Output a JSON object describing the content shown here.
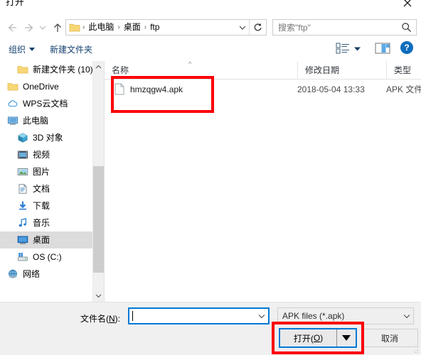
{
  "window": {
    "title": "打开",
    "close_label": "×",
    "close_icon": "close-icon"
  },
  "navigation": {
    "back_icon": "arrow-left-icon",
    "forward_icon": "arrow-right-icon",
    "recent_icon": "chevron-down-icon",
    "up_icon": "arrow-up-icon",
    "address": {
      "folder_icon": "folder-icon",
      "crumbs": [
        "此电脑",
        "桌面",
        "ftp"
      ],
      "separator": "›",
      "dropdown_icon": "chevron-down-icon",
      "refresh_icon": "refresh-icon"
    },
    "search": {
      "placeholder": "搜索\"ftp\"",
      "icon": "search-icon"
    }
  },
  "toolbar": {
    "organize_label": "组织",
    "new_folder_label": "新建文件夹",
    "view_options_icon": "view-options-icon",
    "view_caret_icon": "chevron-down-icon",
    "preview_pane_icon": "preview-pane-icon",
    "help_label": "?",
    "help_icon": "help-icon"
  },
  "sidebar": {
    "items": [
      {
        "label": "新建文件夹 (10)",
        "icon": "folder-icon",
        "indent": true,
        "selected": false
      },
      {
        "label": "OneDrive",
        "icon": "folder-icon",
        "indent": false,
        "selected": false
      },
      {
        "label": "WPS云文档",
        "icon": "cloud-icon",
        "indent": false,
        "selected": false
      },
      {
        "label": "此电脑",
        "icon": "this-pc-icon",
        "indent": false,
        "selected": false
      },
      {
        "label": "3D 对象",
        "icon": "3d-objects-icon",
        "indent": true,
        "selected": false
      },
      {
        "label": "视频",
        "icon": "videos-icon",
        "indent": true,
        "selected": false
      },
      {
        "label": "图片",
        "icon": "pictures-icon",
        "indent": true,
        "selected": false
      },
      {
        "label": "文档",
        "icon": "documents-icon",
        "indent": true,
        "selected": false
      },
      {
        "label": "下载",
        "icon": "downloads-icon",
        "indent": true,
        "selected": false
      },
      {
        "label": "音乐",
        "icon": "music-icon",
        "indent": true,
        "selected": false
      },
      {
        "label": "桌面",
        "icon": "desktop-icon",
        "indent": true,
        "selected": true
      },
      {
        "label": "OS (C:)",
        "icon": "disk-drive-icon",
        "indent": true,
        "selected": false
      },
      {
        "label": "网络",
        "icon": "network-icon",
        "indent": false,
        "selected": false
      }
    ],
    "scroll_up_icon": "chevron-up-icon",
    "scroll_down_icon": "chevron-down-icon"
  },
  "file_list": {
    "columns": [
      "名称",
      "修改日期",
      "类型"
    ],
    "sort_indicator": "^",
    "rows": [
      {
        "name": "hmzqgw4.apk",
        "modified": "2018-05-04 13:33",
        "type": "APK 文件",
        "icon": "file-icon"
      }
    ],
    "hscroll_left_icon": "chevron-left-icon",
    "hscroll_right_icon": "chevron-right-icon"
  },
  "footer": {
    "filename_label_prefix": "文件名(",
    "filename_label_key": "N",
    "filename_label_suffix": "):",
    "filename_value": "",
    "filename_dropdown_icon": "chevron-down-icon",
    "filter_value": "APK files (*.apk)",
    "filter_dropdown_icon": "chevron-down-icon",
    "open_label_prefix": "打开(",
    "open_label_key": "O",
    "open_label_suffix": ")",
    "open_split_icon": "triangle-down-icon",
    "cancel_label": "取消",
    "resize_grip_icon": "resize-grip-icon"
  },
  "annotations": {
    "color": "#fb0007",
    "boxes": [
      "selected-file-highlight",
      "open-button-highlight"
    ]
  }
}
